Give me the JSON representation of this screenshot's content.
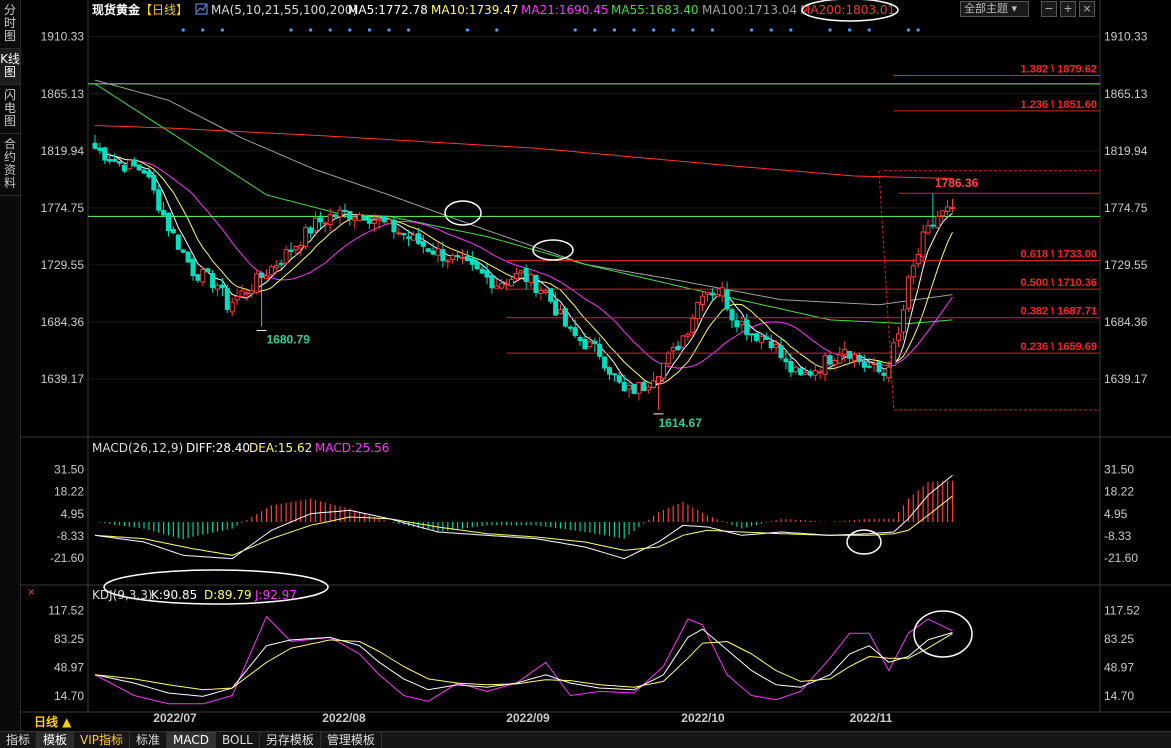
{
  "sidebar": {
    "items": [
      {
        "label": "分时图"
      },
      {
        "label": "K线图"
      },
      {
        "label": "闪电图"
      },
      {
        "label": "合约资料"
      }
    ]
  },
  "header": {
    "title": "现货黄金",
    "period": "【日线】",
    "ma_params": "MA(5,10,21,55,100,200)",
    "ma5": "MA5:1772.78",
    "ma10": "MA10:1739.47",
    "ma21": "MA21:1690.45",
    "ma55": "MA55:1683.40",
    "ma100": "MA100:1713.04",
    "ma200": "MA200:1803.01",
    "theme_select": "全部主题",
    "colors": {
      "ma5": "#ffffff",
      "ma10": "#ffff66",
      "ma21": "#ff33ff",
      "ma55": "#44dd44",
      "ma100": "#a0a0a0",
      "ma200": "#ff3333"
    }
  },
  "macd_header": {
    "name": "MACD(26,12,9)",
    "diff": "DIFF:28.40",
    "dea": "DEA:15.62",
    "macd": "MACD:25.56"
  },
  "kdj_header": {
    "name": "KDJ(9,3,3)",
    "k": "K:90.85",
    "d": "D:89.79",
    "j": "J:92.97"
  },
  "period_label": "日线 ▲",
  "bottom_tabs": [
    "指标",
    "模板",
    "VIP指标",
    "标准",
    "MACD",
    "BOLL",
    "另存模板",
    "管理模板"
  ],
  "chart_data": [
    {
      "type": "candlestick",
      "title": "现货黄金 日线",
      "y_ticks": [
        "1910.33",
        "1865.13",
        "1819.94",
        "1774.75",
        "1729.55",
        "1684.36",
        "1639.17"
      ],
      "ylim": [
        1594,
        1922
      ],
      "x_ticks": [
        "2022/07",
        "2022/08",
        "2022/09",
        "2022/10",
        "2022/11"
      ],
      "annotations": [
        "1680.79",
        "1614.67",
        "1786.36"
      ],
      "fib_levels": [
        {
          "label": "1.382 \\ 1879.62",
          "value": 1879.62
        },
        {
          "label": "1.236 \\ 1851.60",
          "value": 1851.6
        },
        {
          "label": "0.618 \\ 1733.00",
          "value": 1733.0
        },
        {
          "label": "0.500 \\ 1710.36",
          "value": 1710.36
        },
        {
          "label": "0.382 \\ 1687.71",
          "value": 1687.71
        },
        {
          "label": "0.236 \\ 1659.69",
          "value": 1659.69
        }
      ],
      "fib_range": [
        1614.67,
        1804.17
      ],
      "horizontal_lines": [
        1786.36,
        1768.0
      ],
      "series": [
        {
          "name": "MA5",
          "color": "#ffffff"
        },
        {
          "name": "MA10",
          "color": "#ffff66"
        },
        {
          "name": "MA21",
          "color": "#ff33ff"
        },
        {
          "name": "MA55",
          "color": "#44dd44"
        },
        {
          "name": "MA100",
          "color": "#a0a0a0"
        },
        {
          "name": "MA200",
          "color": "#ff3333"
        }
      ],
      "anchors": [
        [
          0,
          1822
        ],
        [
          5,
          1810
        ],
        [
          10,
          1805
        ],
        [
          15,
          1760
        ],
        [
          20,
          1725
        ],
        [
          25,
          1714
        ],
        [
          27,
          1698
        ],
        [
          32,
          1713
        ],
        [
          40,
          1742
        ],
        [
          45,
          1762
        ],
        [
          49,
          1770
        ],
        [
          55,
          1770
        ],
        [
          60,
          1760
        ],
        [
          67,
          1745
        ],
        [
          75,
          1730
        ],
        [
          82,
          1715
        ],
        [
          87,
          1722
        ],
        [
          92,
          1708
        ],
        [
          97,
          1675
        ],
        [
          103,
          1660
        ],
        [
          108,
          1628
        ],
        [
          112,
          1634
        ],
        [
          118,
          1660
        ],
        [
          121,
          1680
        ],
        [
          124,
          1710
        ],
        [
          128,
          1708
        ],
        [
          130,
          1690
        ],
        [
          134,
          1676
        ],
        [
          138,
          1670
        ],
        [
          141,
          1650
        ],
        [
          144,
          1640
        ],
        [
          148,
          1650
        ],
        [
          153,
          1665
        ],
        [
          157,
          1650
        ],
        [
          161,
          1643
        ],
        [
          164,
          1673
        ],
        [
          166,
          1715
        ],
        [
          169,
          1750
        ],
        [
          172,
          1768
        ],
        [
          174,
          1772
        ],
        [
          175,
          1770
        ]
      ],
      "ma200_points": [
        [
          0,
          1840
        ],
        [
          15,
          1838
        ],
        [
          46,
          1832
        ],
        [
          90,
          1822
        ],
        [
          130,
          1808
        ],
        [
          155,
          1800
        ],
        [
          175,
          1798
        ]
      ],
      "ma100_points": [
        [
          0,
          1876
        ],
        [
          15,
          1860
        ],
        [
          30,
          1830
        ],
        [
          45,
          1805
        ],
        [
          60,
          1785
        ],
        [
          80,
          1757
        ],
        [
          100,
          1730
        ],
        [
          118,
          1718
        ],
        [
          140,
          1702
        ],
        [
          160,
          1698
        ],
        [
          175,
          1706
        ]
      ],
      "ma55_points": [
        [
          0,
          1873
        ],
        [
          18,
          1828
        ],
        [
          35,
          1785
        ],
        [
          50,
          1770
        ],
        [
          60,
          1768
        ],
        [
          80,
          1752
        ],
        [
          100,
          1730
        ],
        [
          120,
          1712
        ],
        [
          150,
          1686
        ],
        [
          166,
          1683
        ],
        [
          175,
          1686
        ]
      ]
    },
    {
      "type": "macd",
      "title": "MACD(26,12,9)",
      "y_ticks": [
        "31.50",
        "18.22",
        "4.95",
        "-8.33",
        "-21.60"
      ],
      "ylim": [
        -36,
        42
      ],
      "series": [
        {
          "name": "DIFF",
          "color": "#ffffff"
        },
        {
          "name": "DEA",
          "color": "#ffff66"
        },
        {
          "name": "MACD",
          "color": "#ff33ff"
        }
      ],
      "diff_anchors": [
        [
          0,
          -8
        ],
        [
          10,
          -12
        ],
        [
          18,
          -20
        ],
        [
          28,
          -22
        ],
        [
          36,
          -5
        ],
        [
          44,
          5
        ],
        [
          52,
          7
        ],
        [
          60,
          2
        ],
        [
          70,
          -6
        ],
        [
          80,
          -8
        ],
        [
          90,
          -10
        ],
        [
          100,
          -15
        ],
        [
          108,
          -22
        ],
        [
          115,
          -12
        ],
        [
          120,
          -2
        ],
        [
          125,
          -3
        ],
        [
          132,
          -8
        ],
        [
          140,
          -6
        ],
        [
          150,
          -8
        ],
        [
          158,
          -7
        ],
        [
          163,
          -6
        ],
        [
          166,
          2
        ],
        [
          170,
          16
        ],
        [
          175,
          28
        ]
      ],
      "dea_anchors": [
        [
          0,
          -8
        ],
        [
          10,
          -10
        ],
        [
          20,
          -16
        ],
        [
          28,
          -20
        ],
        [
          36,
          -10
        ],
        [
          44,
          -2
        ],
        [
          52,
          3
        ],
        [
          60,
          2
        ],
        [
          70,
          -3
        ],
        [
          80,
          -7
        ],
        [
          90,
          -9
        ],
        [
          100,
          -12
        ],
        [
          108,
          -17
        ],
        [
          115,
          -15
        ],
        [
          120,
          -8
        ],
        [
          125,
          -5
        ],
        [
          132,
          -6
        ],
        [
          140,
          -7
        ],
        [
          150,
          -8
        ],
        [
          158,
          -8
        ],
        [
          163,
          -7
        ],
        [
          166,
          -5
        ],
        [
          170,
          4
        ],
        [
          175,
          15.6
        ]
      ]
    },
    {
      "type": "kdj",
      "title": "KDJ(9,3,3)",
      "y_ticks": [
        "117.52",
        "83.25",
        "48.97",
        "14.70"
      ],
      "ylim": [
        0,
        130
      ],
      "series": [
        {
          "name": "K",
          "color": "#ffffff"
        },
        {
          "name": "D",
          "color": "#ffff66"
        },
        {
          "name": "J",
          "color": "#ff33ff"
        }
      ],
      "j_anchors": [
        [
          0,
          40
        ],
        [
          8,
          15
        ],
        [
          15,
          5
        ],
        [
          22,
          5
        ],
        [
          28,
          15
        ],
        [
          35,
          110
        ],
        [
          40,
          80
        ],
        [
          48,
          85
        ],
        [
          54,
          65
        ],
        [
          58,
          40
        ],
        [
          63,
          15
        ],
        [
          68,
          8
        ],
        [
          74,
          30
        ],
        [
          80,
          20
        ],
        [
          86,
          30
        ],
        [
          92,
          55
        ],
        [
          97,
          15
        ],
        [
          103,
          20
        ],
        [
          110,
          18
        ],
        [
          116,
          50
        ],
        [
          121,
          107
        ],
        [
          124,
          100
        ],
        [
          129,
          40
        ],
        [
          134,
          15
        ],
        [
          139,
          10
        ],
        [
          144,
          20
        ],
        [
          150,
          60
        ],
        [
          154,
          90
        ],
        [
          158,
          90
        ],
        [
          162,
          45
        ],
        [
          166,
          90
        ],
        [
          170,
          107
        ],
        [
          175,
          93
        ]
      ],
      "k_anchors": [
        [
          0,
          40
        ],
        [
          8,
          30
        ],
        [
          15,
          18
        ],
        [
          22,
          14
        ],
        [
          28,
          24
        ],
        [
          35,
          75
        ],
        [
          40,
          82
        ],
        [
          48,
          85
        ],
        [
          54,
          75
        ],
        [
          58,
          55
        ],
        [
          63,
          35
        ],
        [
          68,
          22
        ],
        [
          74,
          28
        ],
        [
          80,
          25
        ],
        [
          86,
          30
        ],
        [
          92,
          40
        ],
        [
          97,
          30
        ],
        [
          103,
          24
        ],
        [
          110,
          22
        ],
        [
          116,
          40
        ],
        [
          121,
          85
        ],
        [
          124,
          95
        ],
        [
          129,
          70
        ],
        [
          134,
          45
        ],
        [
          139,
          28
        ],
        [
          144,
          25
        ],
        [
          150,
          40
        ],
        [
          154,
          65
        ],
        [
          158,
          75
        ],
        [
          162,
          55
        ],
        [
          166,
          62
        ],
        [
          170,
          82
        ],
        [
          175,
          90.85
        ]
      ],
      "d_anchors": [
        [
          0,
          40
        ],
        [
          8,
          35
        ],
        [
          15,
          28
        ],
        [
          22,
          22
        ],
        [
          28,
          24
        ],
        [
          35,
          55
        ],
        [
          40,
          72
        ],
        [
          48,
          82
        ],
        [
          54,
          80
        ],
        [
          58,
          68
        ],
        [
          63,
          50
        ],
        [
          68,
          35
        ],
        [
          74,
          30
        ],
        [
          80,
          28
        ],
        [
          86,
          29
        ],
        [
          92,
          34
        ],
        [
          97,
          33
        ],
        [
          103,
          28
        ],
        [
          110,
          25
        ],
        [
          116,
          32
        ],
        [
          121,
          60
        ],
        [
          124,
          78
        ],
        [
          129,
          80
        ],
        [
          134,
          65
        ],
        [
          139,
          45
        ],
        [
          144,
          32
        ],
        [
          150,
          35
        ],
        [
          154,
          50
        ],
        [
          158,
          62
        ],
        [
          162,
          60
        ],
        [
          166,
          60
        ],
        [
          170,
          72
        ],
        [
          175,
          89.79
        ]
      ]
    }
  ]
}
